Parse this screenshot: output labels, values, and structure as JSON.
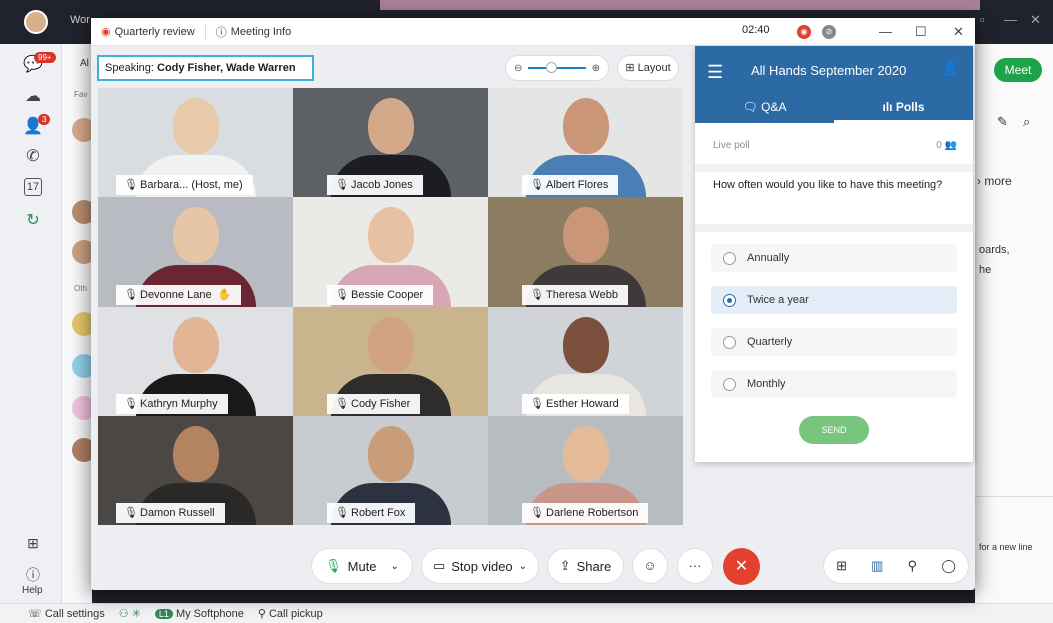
{
  "background_app": {
    "title_partial": "Wor",
    "rail_badge": "99+",
    "rail_badge2": "3",
    "help_label": "Help",
    "list_tab_partial": "Al",
    "list_fav_partial": "Fav",
    "list_other_partial": "Oth",
    "meet_label": "Meet",
    "right_text_1": "› more",
    "right_text_2": "oards,",
    "right_text_3": "he",
    "right_text_4": "for a new line",
    "status": {
      "call_settings": "Call settings",
      "softphone_badge": "L1",
      "softphone": "My Softphone",
      "call_pickup": "Call pickup"
    }
  },
  "meeting": {
    "tab_quarterly": "Quarterly review",
    "tab_info": "Meeting Info",
    "timer": "02:40",
    "speaking_prefix": "Speaking:",
    "speaking_names": "Cody Fisher, Wade Warren",
    "layout_label": "Layout",
    "participants": [
      {
        "name": "Barbara... (Host, me)",
        "bg": "#d9dde1",
        "head": "#e8c9a8",
        "body": "#f1f1ef"
      },
      {
        "name": "Jacob Jones",
        "bg": "#5d6165",
        "head": "#d4a98a",
        "body": "#1b1d22"
      },
      {
        "name": "Albert Flores",
        "bg": "#e4e6e6",
        "head": "#c99677",
        "body": "#4a7fb5"
      },
      {
        "name": "Devonne Lane",
        "bg": "#b8bcc2",
        "head": "#e7c6a6",
        "body": "#6a2733"
      },
      {
        "name": "Bessie Cooper",
        "bg": "#eceae7",
        "head": "#e6c1a4",
        "body": "#d8a7b6"
      },
      {
        "name": "Theresa Webb",
        "bg": "#8c7c62",
        "head": "#c99678",
        "body": "#3f3a39"
      },
      {
        "name": "Kathryn Murphy",
        "bg": "#dfe1e4",
        "head": "#e1b595",
        "body": "#1a1a1a"
      },
      {
        "name": "Cody Fisher",
        "bg": "#c9b48e",
        "head": "#d1a383",
        "body": "#2e2d2c"
      },
      {
        "name": "Esther Howard",
        "bg": "#d0d4d8",
        "head": "#7a4f3b",
        "body": "#e9e6e2"
      },
      {
        "name": "Damon Russell",
        "bg": "#4a4744",
        "head": "#b3845f",
        "body": "#2a2927"
      },
      {
        "name": "Robert Fox",
        "bg": "#c8ccd1",
        "head": "#c99c7a",
        "body": "#2d3240"
      },
      {
        "name": "Darlene Robertson",
        "bg": "#b7bcc0",
        "head": "#e3bb98",
        "body": "#c99588"
      }
    ],
    "controls": {
      "mute": "Mute",
      "stop_video": "Stop video",
      "share": "Share"
    }
  },
  "panel": {
    "title": "All Hands September 2020",
    "tab_qa": "Q&A",
    "tab_polls": "Polls",
    "live_poll": "Live poll",
    "live_count": "0",
    "question": "How often would you like to have this meeting?",
    "options": [
      "Annually",
      "Twice a year",
      "Quarterly",
      "Monthly"
    ],
    "selected_option": "Twice a year",
    "send": "SEND"
  }
}
